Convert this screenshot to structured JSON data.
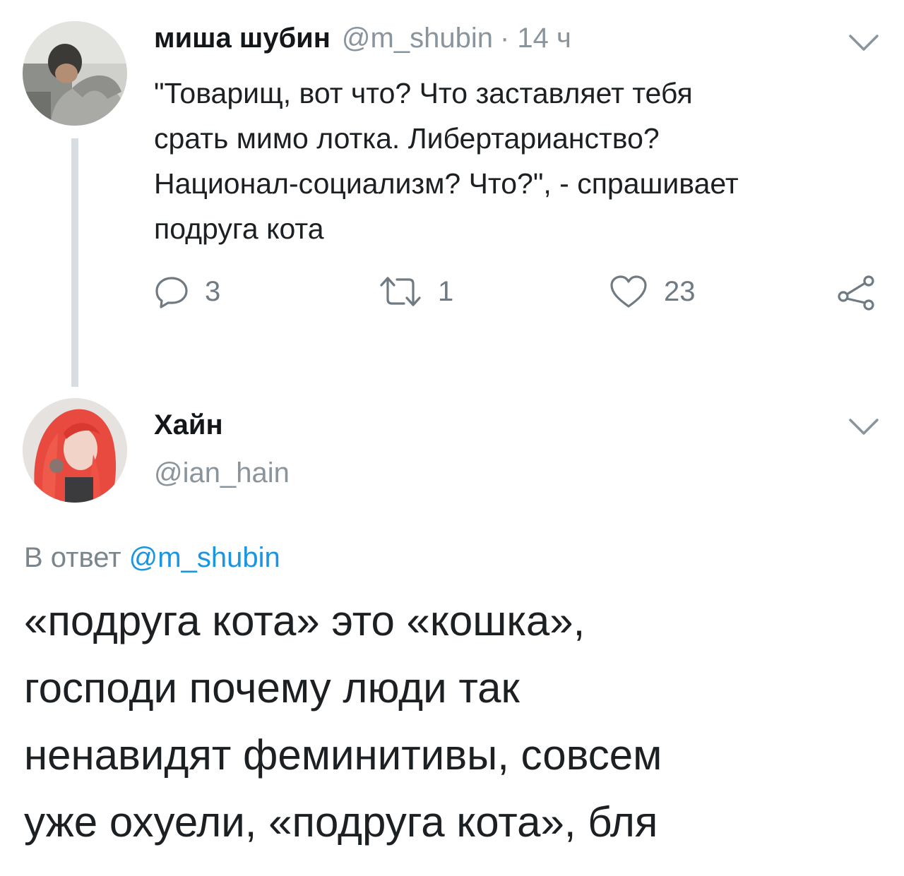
{
  "tweet1": {
    "author_name": "миша шубин",
    "handle": "@m_shubin",
    "time": "· 14 ч",
    "text_lines": [
      "\"Товарищ, вот что? Что заставляет тебя",
      "срать мимо лотка. Либертарианство?",
      "Национал-социализм? Что?\", - спрашивает",
      "подруга кота"
    ],
    "actions": {
      "reply_icon": "reply-icon",
      "reply_count": "3",
      "retweet_icon": "retweet-icon",
      "retweet_count": "1",
      "like_icon": "heart-icon",
      "like_count": "23",
      "share_icon": "share-icon"
    },
    "menu_icon": "chevron-down-icon"
  },
  "tweet2": {
    "author_name": "Хайн",
    "handle": "@ian_hain",
    "reply_prefix": "В ответ",
    "reply_mention": "@m_shubin",
    "text_lines": [
      "«подруга кота» это «кошка»,",
      "господи почему люди так",
      "ненавидят феминитивы, совсем",
      "уже охуели, «подруга кота», бля"
    ],
    "menu_icon": "chevron-down-icon"
  },
  "colors": {
    "text": "#1c2022",
    "muted": "#8a949c",
    "link": "#1b95e0",
    "thread_line": "#d7dde2"
  }
}
